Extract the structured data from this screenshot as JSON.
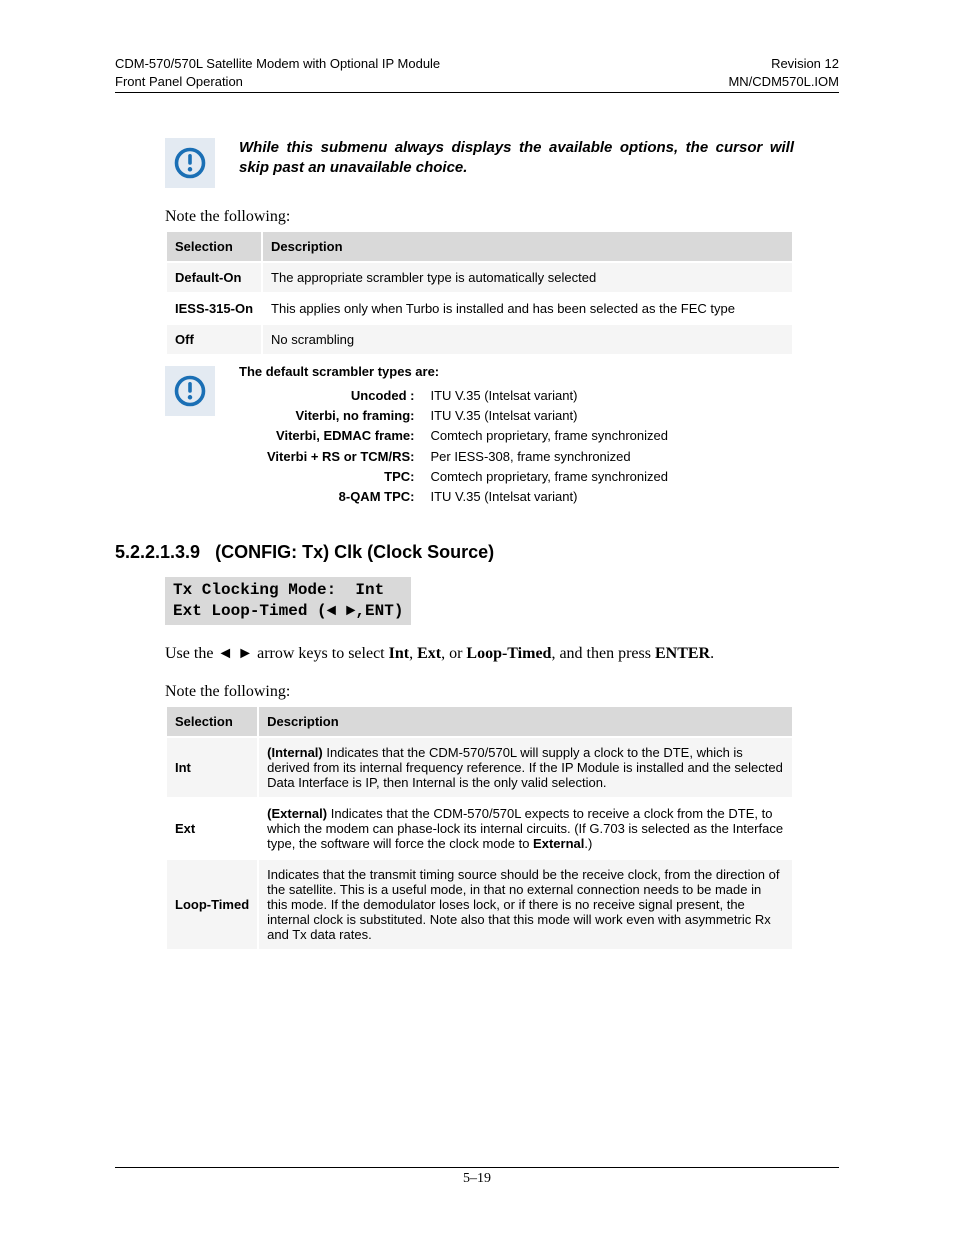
{
  "header": {
    "left1": "CDM-570/570L Satellite Modem with Optional IP Module",
    "left2": "Front Panel Operation",
    "right1": "Revision 12",
    "right2": "MN/CDM570L.IOM"
  },
  "note1": "While this submenu always displays the available options, the cursor will skip past an unavailable choice.",
  "note_following": "Note the following:",
  "table1": {
    "h1": "Selection",
    "h2": "Description",
    "rows": [
      {
        "sel": "Default-On",
        "desc": "The appropriate scrambler type is automatically selected"
      },
      {
        "sel": "IESS-315-On",
        "desc": "This applies only when Turbo is installed and has been selected as the FEC type"
      },
      {
        "sel": "Off",
        "desc": "No scrambling"
      }
    ]
  },
  "scrambler": {
    "intro": "The default scrambler types are:",
    "items": [
      {
        "k": "Uncoded :",
        "v": "ITU V.35 (Intelsat variant)"
      },
      {
        "k": "Viterbi, no framing:",
        "v": "ITU V.35 (Intelsat variant)"
      },
      {
        "k": "Viterbi, EDMAC frame:",
        "v": "Comtech proprietary, frame synchronized"
      },
      {
        "k": "Viterbi + RS or TCM/RS:",
        "v": "Per IESS-308, frame synchronized"
      },
      {
        "k": "TPC:",
        "v": "Comtech proprietary, frame synchronized"
      },
      {
        "k": "8-QAM TPC:",
        "v": "ITU V.35 (Intelsat variant)"
      }
    ]
  },
  "section": {
    "num": "5.2.2.1.3.9",
    "title": "(CONFIG: Tx) Clk (Clock Source)"
  },
  "lcd": "Tx Clocking Mode:  Int\nExt Loop-Timed (◄ ►,ENT)",
  "para1_pre": "Use the ◄ ► arrow keys to select ",
  "para1_b1": "Int",
  "para1_m1": ", ",
  "para1_b2": "Ext",
  "para1_m2": ", or ",
  "para1_b3": "Loop-Timed",
  "para1_m3": ", and then press ",
  "para1_b4": "ENTER",
  "para1_end": ".",
  "table2": {
    "h1": "Selection",
    "h2": "Description",
    "rows": [
      {
        "sel": "Int",
        "prefix": "(Internal)",
        "desc": " Indicates that the CDM-570/570L will supply a clock to the DTE, which is derived from its internal frequency reference. If the IP Module is installed and the selected Data Interface is IP, then Internal is the only valid selection."
      },
      {
        "sel": "Ext",
        "prefix": "(External)",
        "desc_pre": " Indicates that the CDM-570/570L expects to receive a clock from the DTE, to which the modem can phase-lock its internal circuits. (If G.703 is selected as the Interface type, the software will force the clock mode to ",
        "bold_mid": "External",
        "desc_post": ".)"
      },
      {
        "sel": "Loop-Timed",
        "prefix": "",
        "desc": "Indicates that the transmit timing source should be the receive clock, from the direction of the satellite. This is a useful mode, in that no external connection needs to be made in this mode. If the demodulator loses lock, or if there is no receive signal present, the internal clock is substituted. Note also that this mode will work even with asymmetric Rx and Tx data rates."
      }
    ]
  },
  "footer": "5–19"
}
